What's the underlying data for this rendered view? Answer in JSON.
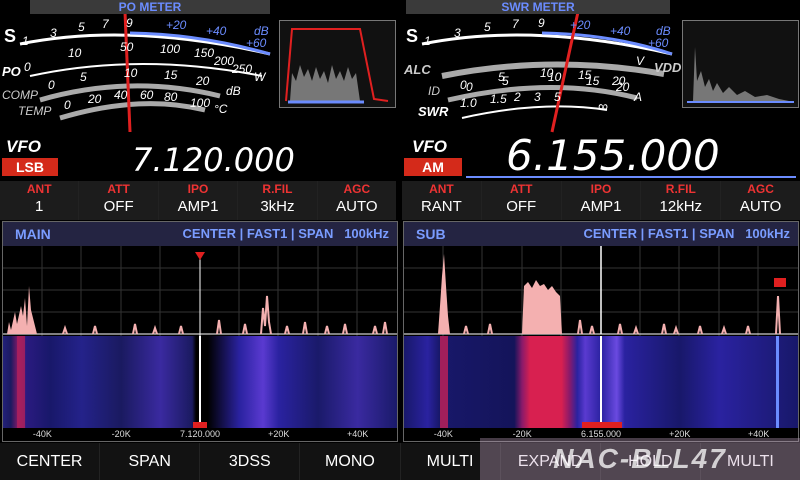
{
  "po_meter": {
    "title": "PO METER",
    "s_label": "S",
    "s_scale": [
      "1",
      "3",
      "5",
      "7",
      "9",
      "+20",
      "+40",
      "+60"
    ],
    "db_label": "dB",
    "po_label": "PO",
    "po_scale": [
      "0",
      "10",
      "50",
      "100",
      "150",
      "200",
      "250"
    ],
    "po_unit": "W",
    "comp_label": "COMP",
    "comp_scale": [
      "0",
      "5",
      "10",
      "15",
      "20"
    ],
    "comp_unit": "dB",
    "temp_label": "TEMP",
    "temp_scale": [
      "0",
      "20",
      "40",
      "60",
      "80",
      "100"
    ],
    "temp_unit": "°C",
    "needle_position": 0.48
  },
  "swr_meter": {
    "title": "SWR METER",
    "s_label": "S",
    "s_scale": [
      "1",
      "3",
      "5",
      "7",
      "9",
      "+20",
      "+40",
      "+60"
    ],
    "db_label": "dB",
    "alc_label": "ALC",
    "vdd_label": "VDD",
    "vdd_scale": [
      "0",
      "5",
      "10",
      "15",
      "20"
    ],
    "vdd_unit": "V",
    "id_label": "ID",
    "id_scale": [
      "0",
      "5",
      "10",
      "15",
      "20"
    ],
    "id_unit": "A",
    "swr_label": "SWR",
    "swr_scale": [
      "1.0",
      "1.5",
      "2",
      "3",
      "5",
      "∞"
    ],
    "needle_position": 0.56
  },
  "main_vfo": {
    "label": "VFO",
    "mode": "LSB",
    "frequency": "7.120.000"
  },
  "sub_vfo": {
    "label": "VFO",
    "mode": "AM",
    "frequency": "6.155.000"
  },
  "main_settings": [
    {
      "title": "ANT",
      "value": "1"
    },
    {
      "title": "ATT",
      "value": "OFF"
    },
    {
      "title": "IPO",
      "value": "AMP1"
    },
    {
      "title": "R.FIL",
      "value": "3kHz"
    },
    {
      "title": "AGC",
      "value": "AUTO"
    }
  ],
  "sub_settings": [
    {
      "title": "ANT",
      "value": "RANT"
    },
    {
      "title": "ATT",
      "value": "OFF"
    },
    {
      "title": "IPO",
      "value": "AMP1"
    },
    {
      "title": "R.FIL",
      "value": "12kHz"
    },
    {
      "title": "AGC",
      "value": "AUTO"
    }
  ],
  "main_scope": {
    "name": "MAIN",
    "mode": "CENTER",
    "speed": "FAST1",
    "span_label": "SPAN",
    "span": "100kHz",
    "axis": [
      "-40K",
      "-20K",
      "7.120.000",
      "+20K",
      "+40K"
    ]
  },
  "sub_scope": {
    "name": "SUB",
    "mode": "CENTER",
    "speed": "FAST1",
    "span_label": "SPAN",
    "span": "100kHz",
    "axis": [
      "-40K",
      "-20K",
      "6.155.000",
      "+20K",
      "+40K"
    ]
  },
  "function_keys": [
    "CENTER",
    "SPAN",
    "3DSS",
    "MONO",
    "MULTI",
    "EXPAND",
    "HOLD",
    "MULTI"
  ],
  "watermark": "NAC-BLL47"
}
